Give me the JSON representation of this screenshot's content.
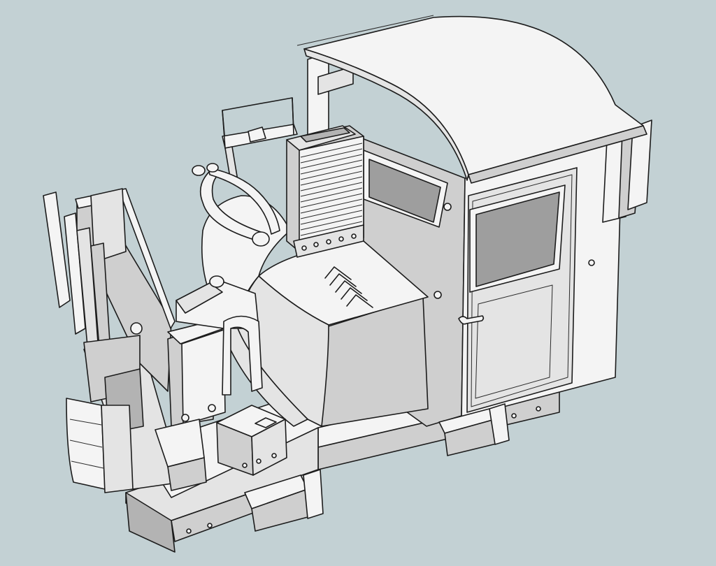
{
  "scene": {
    "background_color": "#c3d1d4",
    "line_color": "#1c1c1c",
    "face_light": "#f4f4f4",
    "face_mid": "#d6d6d6",
    "face_dark": "#b3b3b3",
    "window_glass": "#9e9e9e"
  }
}
